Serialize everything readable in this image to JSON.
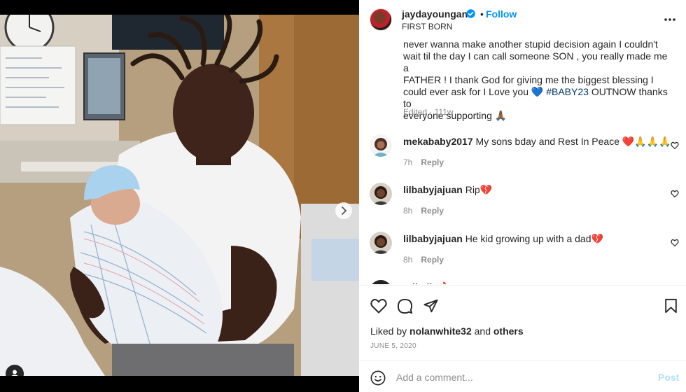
{
  "post": {
    "username": "jaydayoungan",
    "separator": "•",
    "follow_label": "Follow",
    "subtitle": "FIRST BORN",
    "more_icon": "more-horizontal-icon",
    "verified_icon": "verified-badge-icon"
  },
  "caption": {
    "line1": "never wanna make another stupid decision again I couldn't",
    "line2": "wait til the day I can call someone SON , you really made me a",
    "line3": "FATHER ! I thank God for giving me the biggest blessing I",
    "line4_pre": "could ever ask for I Love you 💙",
    "hashtag": "#BABY23",
    "line4_post": "OUTNOW thanks to",
    "line5": "everyone supporting 🙏🏾",
    "meta": "Edited · 111w"
  },
  "comments": [
    {
      "username": "mekababy2017",
      "text": "My sons bday and Rest In Peace ❤️🙏🙏🙏",
      "time": "7h",
      "reply": "Reply"
    },
    {
      "username": "lilbabyjajuan",
      "text": "Rip💔",
      "time": "8h",
      "reply": "Reply"
    },
    {
      "username": "lilbabyjajuan",
      "text": "He kid growing up with a dad💔",
      "time": "8h",
      "reply": "Reply"
    },
    {
      "username": "ndb_jb",
      "text": "🔥",
      "time": "",
      "reply": ""
    }
  ],
  "engagement": {
    "liked_prefix": "Liked by",
    "liked_user": "nolanwhite32",
    "liked_and": "and",
    "liked_others": "others",
    "date": "JUNE 5, 2020"
  },
  "composer": {
    "placeholder": "Add a comment...",
    "post_label": "Post"
  },
  "carousel": {
    "current_index": 1,
    "total": 4
  },
  "colors": {
    "accent": "#0095f6",
    "post_disabled": "#b2dffc",
    "muted": "#8e8e8e",
    "hashtag": "#00376b"
  }
}
